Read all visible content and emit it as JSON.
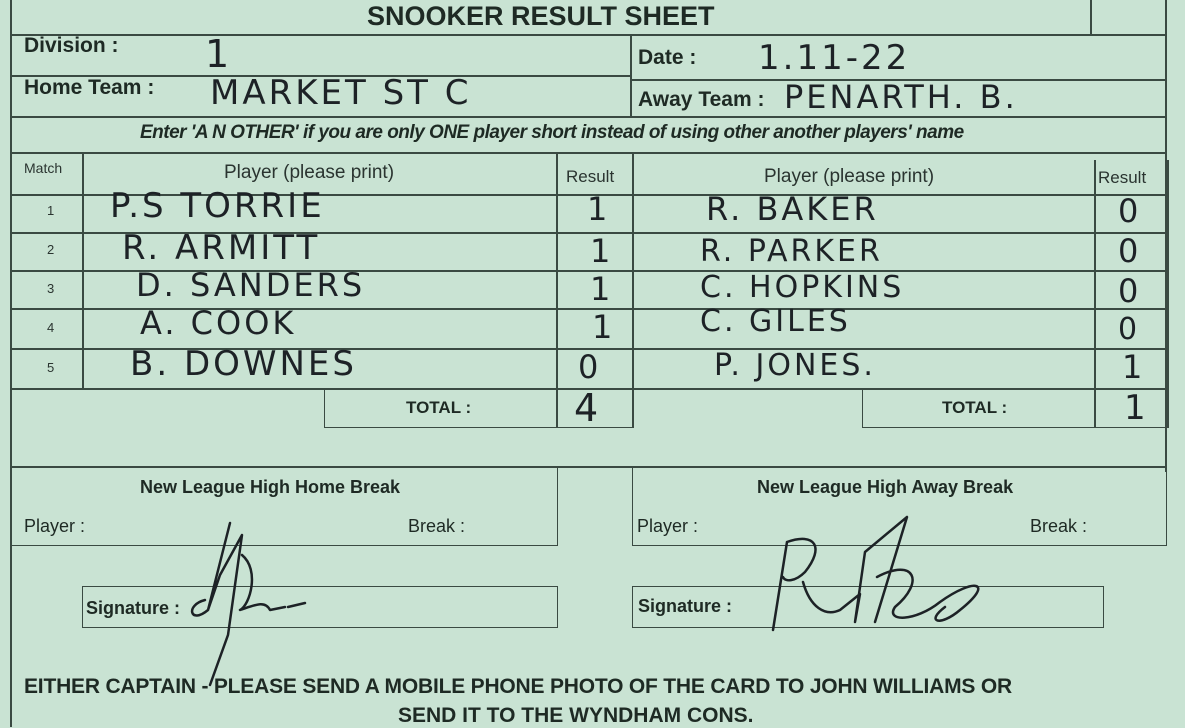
{
  "title": "SNOOKER RESULT SHEET",
  "labels": {
    "division": "Division :",
    "home_team": "Home Team :",
    "date": "Date :",
    "away_team": "Away Team :",
    "instruction": "Enter 'A N OTHER' if you are only ONE player short instead of using other another players' name",
    "match": "Match",
    "player_print": "Player (please print)",
    "result": "Result",
    "total": "TOTAL :",
    "home_break_title": "New League High Home Break",
    "away_break_title": "New League High Away Break",
    "player": "Player :",
    "break": "Break :",
    "signature": "Signature :"
  },
  "values": {
    "division": "1",
    "home_team": "MARKET ST C",
    "date": "1.11-22",
    "away_team": "PENARTH. B."
  },
  "matches": [
    {
      "no": "1",
      "home_player": "P.S TORRIE",
      "home_result": "1",
      "away_player": "R. BAKER",
      "away_result": "0"
    },
    {
      "no": "2",
      "home_player": "R. ARMITT",
      "home_result": "1",
      "away_player": "R. PARKER",
      "away_result": "0"
    },
    {
      "no": "3",
      "home_player": "D. SANDERS",
      "home_result": "1",
      "away_player": "C. HOPKINS",
      "away_result": "0"
    },
    {
      "no": "4",
      "home_player": "A. COOK",
      "home_result": "1",
      "away_player": "C. GILES",
      "away_result": "0"
    },
    {
      "no": "5",
      "home_player": "B. DOWNES",
      "home_result": "0",
      "away_player": "P. JONES.",
      "away_result": "1"
    }
  ],
  "totals": {
    "home": "4",
    "away": "1"
  },
  "footer": {
    "line1": "EITHER CAPTAIN - PLEASE SEND A MOBILE PHONE PHOTO OF THE CARD TO JOHN WILLIAMS OR",
    "line2": "SEND IT TO THE WYNDHAM CONS."
  },
  "colors": {
    "card": "#c9e3d3",
    "ink": "#1d2226",
    "rule": "#3a4a42"
  }
}
